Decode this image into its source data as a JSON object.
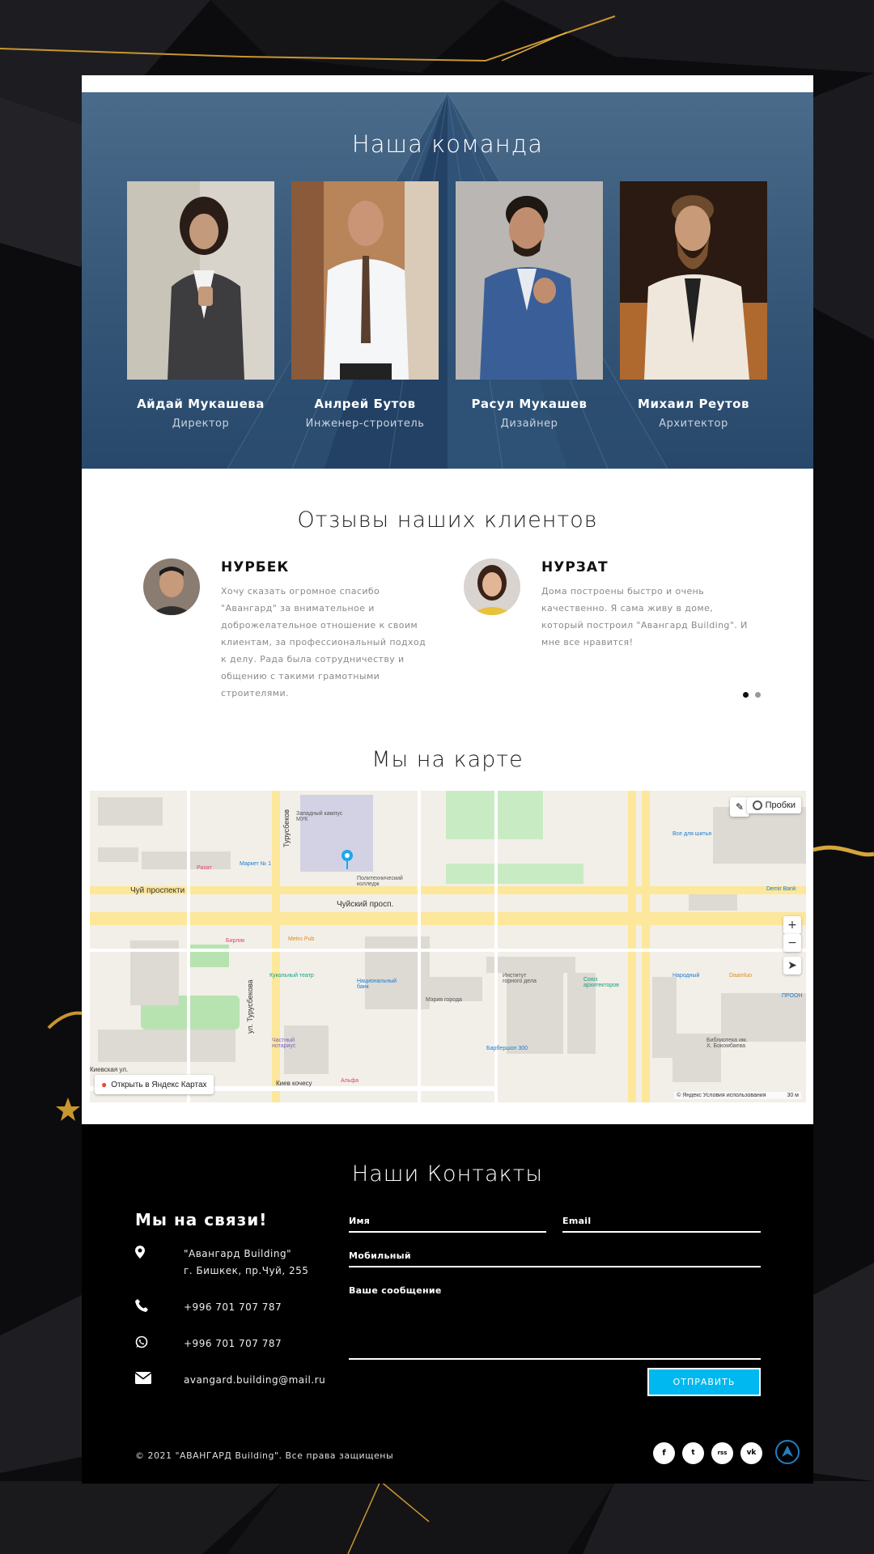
{
  "team": {
    "title": "Наша команда",
    "members": [
      {
        "name": "Айдай Мукашева",
        "role": "Директор"
      },
      {
        "name": "Анлрей Бутов",
        "role": "Инженер-строитель"
      },
      {
        "name": "Расул Мукашев",
        "role": "Дизайнер"
      },
      {
        "name": "Михаил Реутов",
        "role": "Архитектор"
      }
    ]
  },
  "reviews": {
    "title": "Отзывы наших клиентов",
    "items": [
      {
        "name": "НУРБЕК",
        "text": "Хочу сказать огромное спасибо \"Авангард\" за внимательное и доброжелательное отношение к своим клиентам, за профессиональный подход к делу. Рада была сотрудничеству и общению с такими грамотными строителями."
      },
      {
        "name": "НУРЗАТ",
        "text": "Дома построены быстро и очень качественно. Я сама живу в доме, который построил \"Авангард Building\". И мне все нравится!"
      }
    ],
    "pagination": {
      "total": 2,
      "active": 1
    }
  },
  "map": {
    "title": "Мы на карте",
    "open_label": "Открыть в Яндекс Картах",
    "traffic_label": "Пробки",
    "zoom_in": "+",
    "zoom_out": "−",
    "copyright": "© Яндекс   Условия использования",
    "scale": "30 м",
    "labels": {
      "street1": "Чуй проспекти",
      "street2": "Чуйский просп.",
      "street3": "ул. Турусбекова",
      "street4": "Турусбеков",
      "street5": "Киев кочесу",
      "street6": "Киевская ул.",
      "poi1": "Западный кампус МУК",
      "poi2": "Политехнический колледж",
      "poi3": "Маркет № 1",
      "poi4": "Кукольный театр",
      "poi5": "Национальный банк",
      "poi6": "Мэрия города",
      "poi7": "Институт горного дела",
      "poi8": "Союз архитекторов",
      "poi9": "Народный",
      "poi10": "Demir Bank",
      "poi11": "Все для шитья",
      "poi12": "Альфа",
      "poi13": "Metro Pub",
      "poi14": "Барбершоп 300",
      "poi15": "Библиотека им. Х. Бокомбаева",
      "poi16": "Частный нотариус",
      "poi17": "Daamluo",
      "poi18": "Бирлик",
      "poi19": "Рахат",
      "poi20": "ПРООН"
    }
  },
  "contacts": {
    "title": "Наши Контакты",
    "subtitle": "Мы на связи!",
    "address_line1": "\"Авангард Building\"",
    "address_line2": "г. Бишкек, пр.Чуй, 255",
    "phone": "+996 701 707 787",
    "whatsapp": "+996 701 707 787",
    "email": "avangard.building@mail.ru",
    "form": {
      "name_label": "Имя",
      "email_label": "Email",
      "mobile_label": "Мобильный",
      "message_label": "Ваше сообщение",
      "submit_label": "ОТПРАВИТЬ"
    },
    "copyright": "© 2021 \"АВАНГАРД Building\". Все права защищены",
    "socials": [
      "f",
      "t",
      "rss",
      "vk"
    ]
  },
  "colors": {
    "accent": "#00b8f0",
    "gold": "#c9962e",
    "team_bg": "#3a5a7b"
  }
}
